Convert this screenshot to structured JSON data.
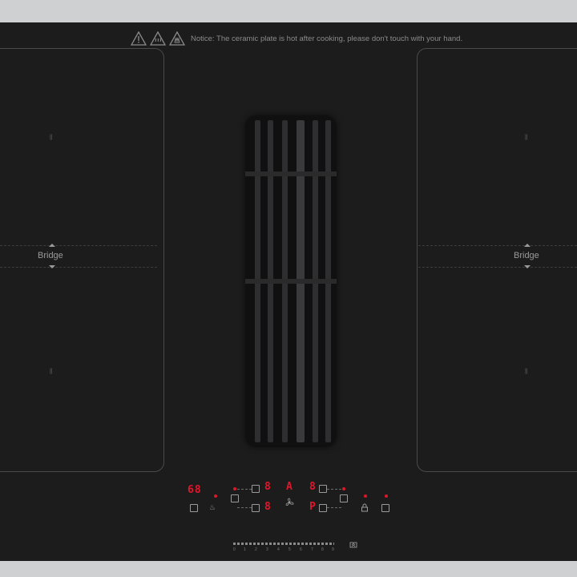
{
  "notice": {
    "text": "Notice:  The ceramic plate is hot after cooking, please don't touch with your hand."
  },
  "zones": {
    "left_bridge_label": "Bridge",
    "right_bridge_label": "Bridge"
  },
  "display": {
    "timer": "68",
    "left_top": "8",
    "left_bottom": "8",
    "center": "A",
    "right_top": "8",
    "right_bottom": "P"
  },
  "slider": {
    "ticks": [
      "0",
      "1",
      "2",
      "3",
      "4",
      "5",
      "6",
      "7",
      "8",
      "9"
    ]
  },
  "icons": {
    "warning": "warning-triangle-icon",
    "hot_surface": "hot-surface-icon",
    "lock": "lock-icon",
    "fan": "fan-icon",
    "boost": "boost-icon"
  },
  "colors": {
    "plate": "#1c1c1d",
    "indicator": "#e0162b",
    "text": "#8a8a8a"
  }
}
